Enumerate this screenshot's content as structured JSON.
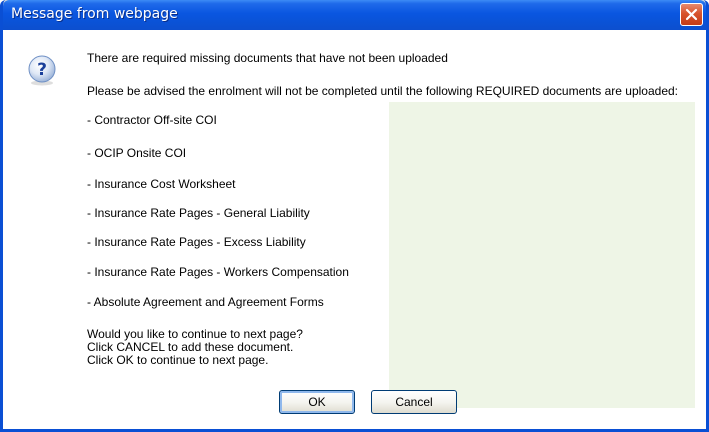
{
  "dialog": {
    "title": "Message from webpage",
    "icon": "question-icon",
    "message": {
      "line1": "There are required missing documents that have not been uploaded",
      "line2": "Please be advised the enrolment will not be completed until the following REQUIRED documents are uploaded:",
      "documents": [
        "- Contractor Off-site COI",
        "- OCIP Onsite COI",
        "- Insurance Cost Worksheet",
        "- Insurance Rate Pages - General Liability",
        "- Insurance Rate Pages - Excess Liability",
        "- Insurance Rate Pages - Workers Compensation",
        "- Absolute Agreement and Agreement Forms"
      ],
      "prompt": [
        "Would you like to continue to next page?",
        "Click CANCEL to add these document.",
        "Click OK to continue to next page."
      ]
    },
    "buttons": {
      "ok_label": "OK",
      "cancel_label": "Cancel"
    }
  },
  "colors": {
    "titlebar": "#0a56e0",
    "border": "#0a4fd4",
    "close_button": "#d8532c",
    "highlight_panel": "#eef5e6"
  }
}
